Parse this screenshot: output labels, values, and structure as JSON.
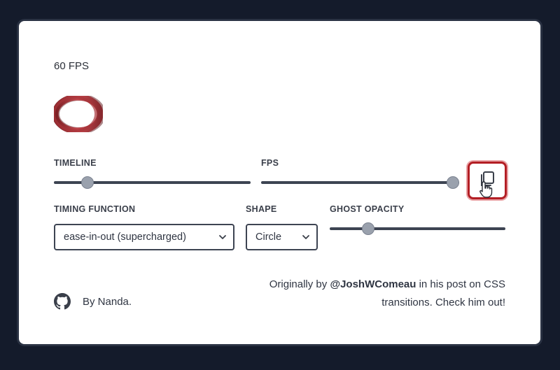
{
  "fps_readout": "60 FPS",
  "timeline": {
    "label": "TIMELINE",
    "value": 0.17
  },
  "fps": {
    "label": "FPS",
    "value": 1.0
  },
  "timing_function": {
    "label": "TIMING FUNCTION",
    "selected": "ease-in-out (supercharged)"
  },
  "shape": {
    "label": "SHAPE",
    "selected": "Circle"
  },
  "ghost_opacity": {
    "label": "GHOST OPACITY",
    "value": 0.22
  },
  "footer": {
    "author": "By Nanda.",
    "credit_prefix": "Originally by",
    "credit_link": "@JoshWComeau",
    "credit_suffix": "in his post on CSS transitions. Check him out!"
  },
  "colors": {
    "accent": "#b31e24",
    "background": "#141b2b",
    "card": "#ffffff",
    "track": "#3d4452"
  },
  "icons": {
    "copy": "copy-icon",
    "github": "github-icon",
    "cursor": "hand-pointer-icon",
    "chevron": "chevron-down-icon"
  }
}
